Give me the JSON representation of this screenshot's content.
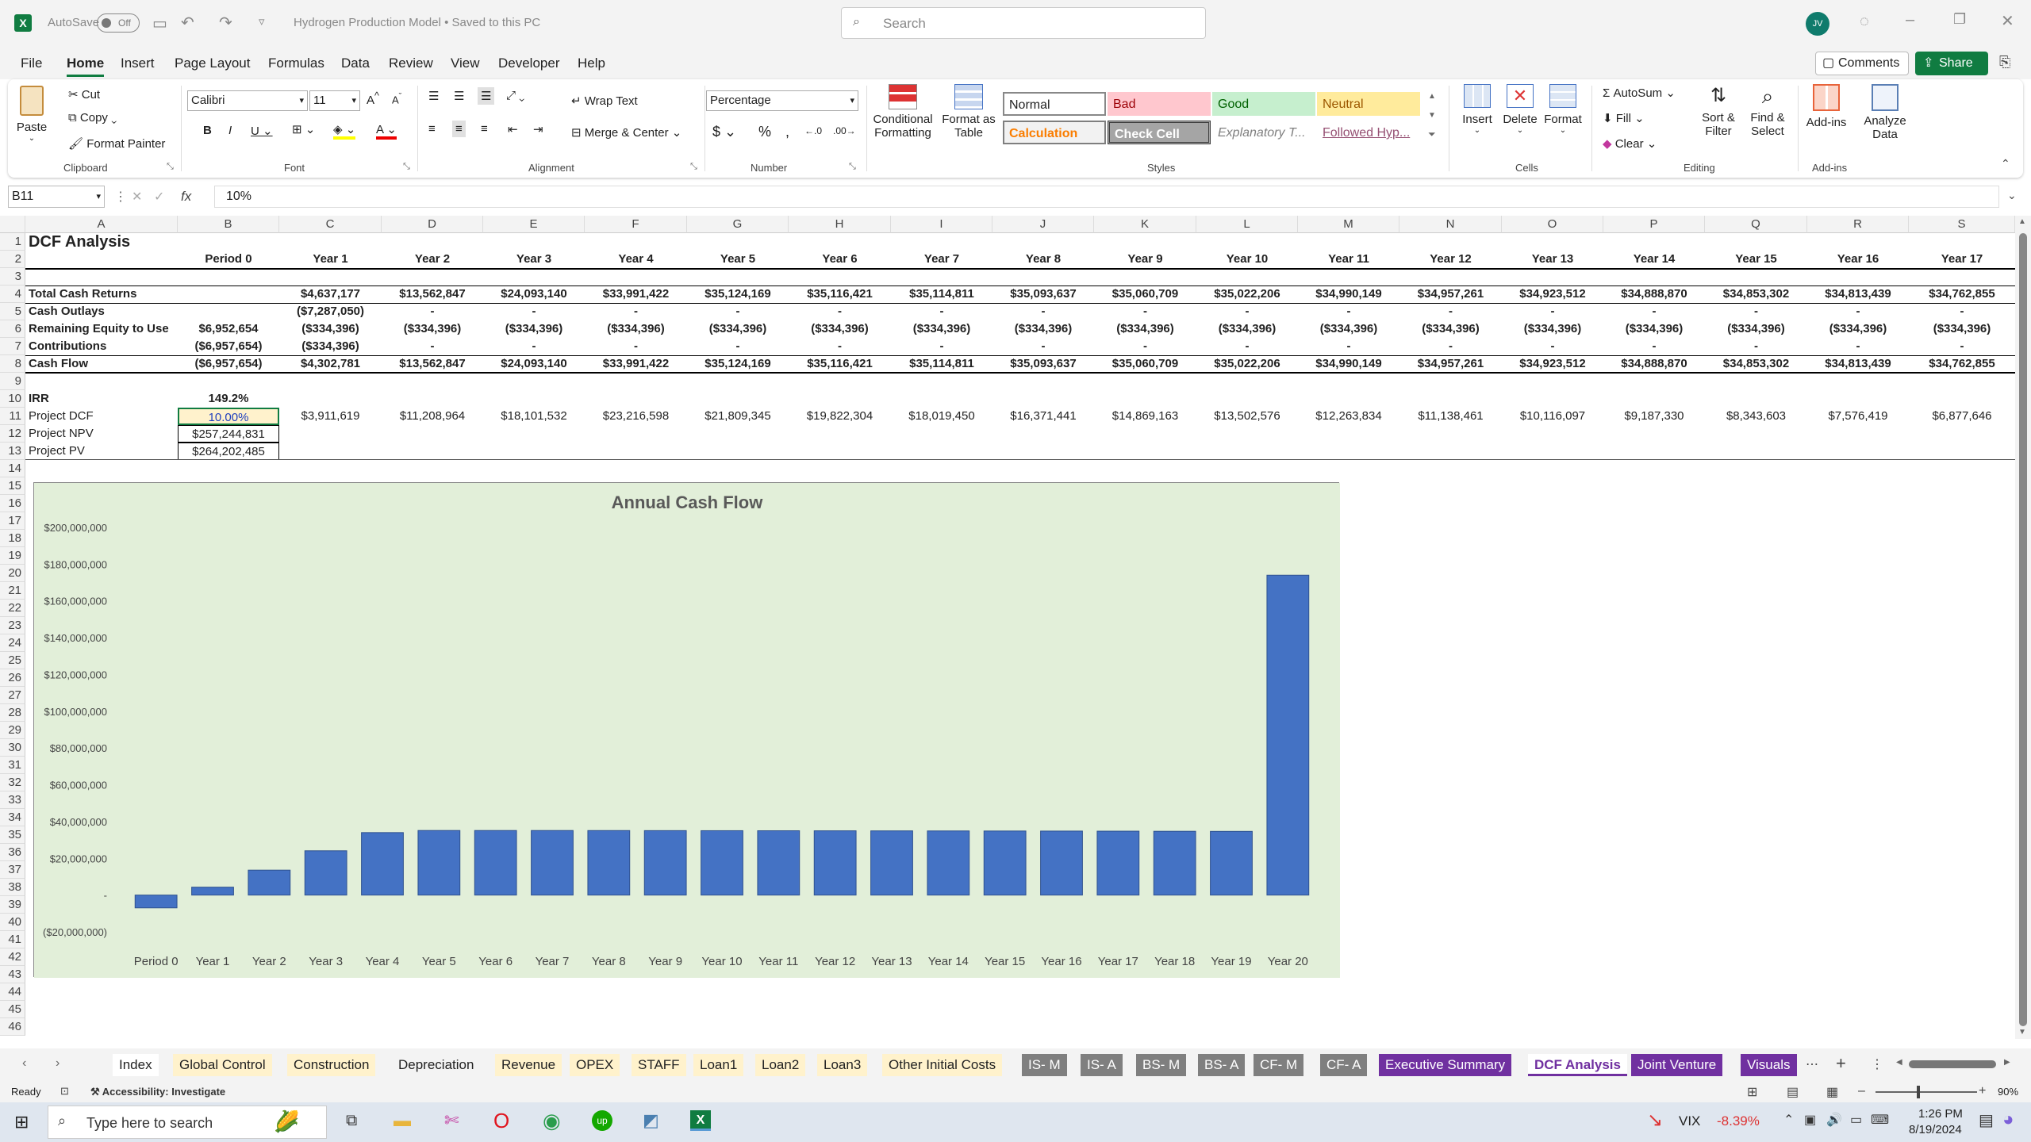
{
  "titlebar": {
    "autosave": "AutoSave",
    "autosave_state": "Off",
    "doc_title": "Hydrogen Production Model • Saved to this PC",
    "search_placeholder": "Search",
    "user_initials": "JV"
  },
  "menu": [
    "File",
    "Home",
    "Insert",
    "Page Layout",
    "Formulas",
    "Data",
    "Review",
    "View",
    "Developer",
    "Help"
  ],
  "menu_right": {
    "comments": "Comments",
    "share": "Share"
  },
  "ribbon": {
    "clipboard": {
      "paste": "Paste",
      "cut": "Cut",
      "copy": "Copy",
      "format_painter": "Format Painter",
      "label": "Clipboard"
    },
    "font": {
      "name": "Calibri",
      "size": "11",
      "label": "Font"
    },
    "alignment": {
      "wrap": "Wrap Text",
      "merge": "Merge & Center",
      "label": "Alignment"
    },
    "number": {
      "format": "Percentage",
      "label": "Number"
    },
    "styles": {
      "cond1": "Conditional",
      "cond2": "Formatting",
      "fmt1": "Format as",
      "fmt2": "Table",
      "normal": "Normal",
      "bad": "Bad",
      "good": "Good",
      "neutral": "Neutral",
      "calculation": "Calculation",
      "check": "Check Cell",
      "explanatory": "Explanatory T...",
      "followed": "Followed Hyp...",
      "label": "Styles"
    },
    "cells": {
      "insert": "Insert",
      "delete": "Delete",
      "format": "Format",
      "label": "Cells"
    },
    "editing": {
      "autosum": "AutoSum",
      "fill": "Fill",
      "clear": "Clear",
      "sort1": "Sort &",
      "sort2": "Filter",
      "find1": "Find &",
      "find2": "Select",
      "label": "Editing"
    },
    "addins": {
      "addins": "Add-ins",
      "analyze1": "Analyze",
      "analyze2": "Data",
      "label": "Add-ins"
    }
  },
  "formula": {
    "namebox": "B11",
    "fx": "fx",
    "value": "10%"
  },
  "columns": [
    "A",
    "B",
    "C",
    "D",
    "E",
    "F",
    "G",
    "H",
    "I",
    "J",
    "K",
    "L",
    "M",
    "N",
    "O",
    "P",
    "Q",
    "R",
    "S"
  ],
  "rows_visible": [
    "1",
    "2",
    "3",
    "4",
    "5",
    "6",
    "7",
    "8",
    "9",
    "10",
    "11",
    "12",
    "13",
    "14",
    "15",
    "16",
    "17",
    "18",
    "19",
    "20",
    "21",
    "22",
    "23",
    "24",
    "25",
    "26",
    "27",
    "28",
    "29",
    "30",
    "31",
    "32",
    "33",
    "34",
    "35",
    "36",
    "37",
    "38",
    "39",
    "40",
    "41",
    "42",
    "43",
    "44",
    "45",
    "46"
  ],
  "sheet": {
    "title": "DCF Analysis",
    "periods": [
      "Period 0",
      "Year 1",
      "Year 2",
      "Year 3",
      "Year 4",
      "Year 5",
      "Year 6",
      "Year 7",
      "Year 8",
      "Year 9",
      "Year 10",
      "Year 11",
      "Year 12",
      "Year 13",
      "Year 14",
      "Year 15",
      "Year 16",
      "Year 17"
    ],
    "rows": [
      {
        "label": "Total Cash Returns",
        "bold": true,
        "vals": [
          "",
          "$4,637,177",
          "$13,562,847",
          "$24,093,140",
          "$33,991,422",
          "$35,124,169",
          "$35,116,421",
          "$35,114,811",
          "$35,093,637",
          "$35,060,709",
          "$35,022,206",
          "$34,990,149",
          "$34,957,261",
          "$34,923,512",
          "$34,888,870",
          "$34,853,302",
          "$34,813,439",
          "$34,762,855"
        ]
      },
      {
        "label": "Cash Outlays",
        "bold": true,
        "vals": [
          "",
          "($7,287,050)",
          "-",
          "-",
          "-",
          "-",
          "-",
          "-",
          "-",
          "-",
          "-",
          "-",
          "-",
          "-",
          "-",
          "-",
          "-",
          "-"
        ]
      },
      {
        "label": "Remaining Equity to Use",
        "bold": true,
        "vals": [
          "$6,952,654",
          "($334,396)",
          "($334,396)",
          "($334,396)",
          "($334,396)",
          "($334,396)",
          "($334,396)",
          "($334,396)",
          "($334,396)",
          "($334,396)",
          "($334,396)",
          "($334,396)",
          "($334,396)",
          "($334,396)",
          "($334,396)",
          "($334,396)",
          "($334,396)",
          "($334,396)"
        ]
      },
      {
        "label": "Contributions",
        "bold": true,
        "vals": [
          "($6,957,654)",
          "($334,396)",
          "-",
          "-",
          "-",
          "-",
          "-",
          "-",
          "-",
          "-",
          "-",
          "-",
          "-",
          "-",
          "-",
          "-",
          "-",
          "-"
        ]
      },
      {
        "label": "Cash Flow",
        "bold": true,
        "vals": [
          "($6,957,654)",
          "$4,302,781",
          "$13,562,847",
          "$24,093,140",
          "$33,991,422",
          "$35,124,169",
          "$35,116,421",
          "$35,114,811",
          "$35,093,637",
          "$35,060,709",
          "$35,022,206",
          "$34,990,149",
          "$34,957,261",
          "$34,923,512",
          "$34,888,870",
          "$34,853,302",
          "$34,813,439",
          "$34,762,855"
        ]
      }
    ],
    "irr_label": "IRR",
    "irr": "149.2%",
    "dcf_label": "Project DCF",
    "dcf_rate": "10.00%",
    "dcf_vals": [
      "$3,911,619",
      "$11,208,964",
      "$18,101,532",
      "$23,216,598",
      "$21,809,345",
      "$19,822,304",
      "$18,019,450",
      "$16,371,441",
      "$14,869,163",
      "$13,502,576",
      "$12,263,834",
      "$11,138,461",
      "$10,116,097",
      "$9,187,330",
      "$8,343,603",
      "$7,576,419",
      "$6,877,646"
    ],
    "npv_label": "Project NPV",
    "npv": "$257,244,831",
    "pv_label": "Project PV",
    "pv": "$264,202,485"
  },
  "chart_data": {
    "type": "bar",
    "title": "Annual Cash Flow",
    "categories": [
      "Period 0",
      "Year 1",
      "Year 2",
      "Year 3",
      "Year 4",
      "Year 5",
      "Year 6",
      "Year 7",
      "Year 8",
      "Year 9",
      "Year 10",
      "Year 11",
      "Year 12",
      "Year 13",
      "Year 14",
      "Year 15",
      "Year 16",
      "Year 17",
      "Year 18",
      "Year 19",
      "Year 20"
    ],
    "values": [
      -6957654,
      4302781,
      13562847,
      24093140,
      33991422,
      35124169,
      35116421,
      35114811,
      35093637,
      35060709,
      35022206,
      34990149,
      34957261,
      34923512,
      34888870,
      34853302,
      34813439,
      34762855,
      34700000,
      34650000,
      174000000
    ],
    "ylim": [
      -20000000,
      200000000
    ],
    "yticks": [
      "$200,000,000",
      "$180,000,000",
      "$160,000,000",
      "$140,000,000",
      "$120,000,000",
      "$100,000,000",
      "$80,000,000",
      "$60,000,000",
      "$40,000,000",
      "$20,000,000",
      "-",
      "($20,000,000)"
    ],
    "bar_color": "#4472c4",
    "bg_color": "#e2efd9"
  },
  "tabs": [
    "Index",
    "Global Control",
    "Construction",
    "Depreciation",
    "Revenue",
    "OPEX",
    "STAFF",
    "Loan1",
    "Loan2",
    "Loan3",
    "Other Initial Costs",
    "IS- M",
    "IS- A",
    "BS- M",
    "BS- A",
    "CF- M",
    "CF- A",
    "Executive Summary",
    "DCF Analysis",
    "Joint Venture",
    "Visuals"
  ],
  "status": {
    "ready": "Ready",
    "accessibility": "Accessibility: Investigate",
    "zoom": "90%"
  },
  "taskbar": {
    "search": "Type here to search",
    "vix": "VIX",
    "vix_change": "-8.39%",
    "time": "1:26 PM",
    "date": "8/19/2024"
  }
}
